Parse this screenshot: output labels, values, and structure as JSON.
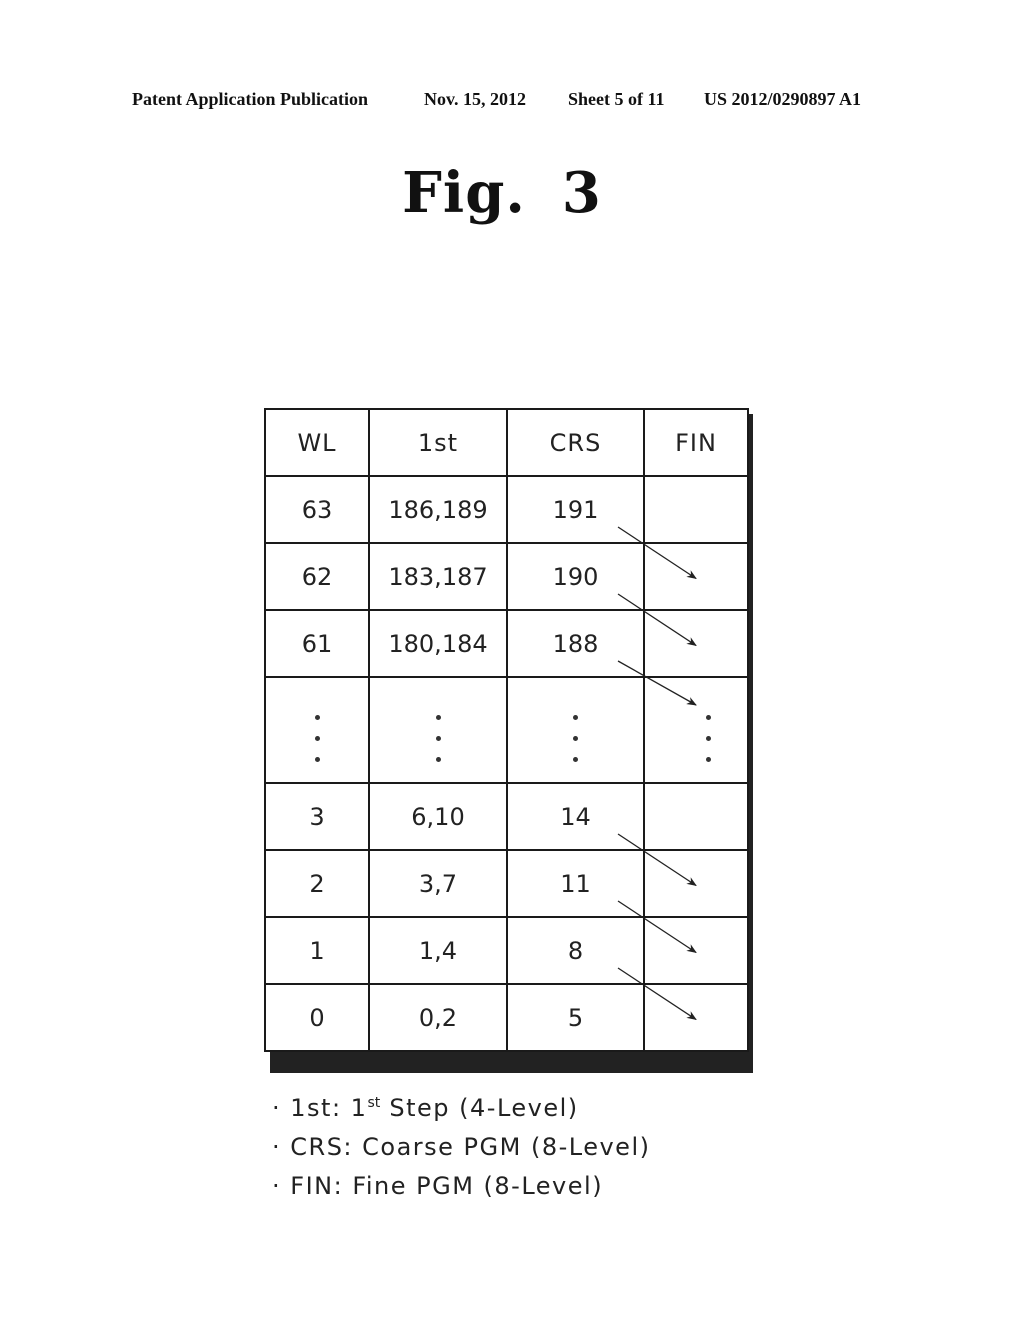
{
  "header": {
    "publication": "Patent Application Publication",
    "date": "Nov. 15, 2012",
    "sheet": "Sheet 5 of 11",
    "number": "US 2012/0290897 A1"
  },
  "figure": {
    "label": "Fig.",
    "number": "3"
  },
  "table": {
    "columns": [
      "WL",
      "1st",
      "CRS",
      "FIN"
    ],
    "rows": [
      {
        "wl": "63",
        "first": "186,189",
        "crs": "191",
        "fin": ""
      },
      {
        "wl": "62",
        "first": "183,187",
        "crs": "190",
        "fin": ""
      },
      {
        "wl": "61",
        "first": "180,184",
        "crs": "188",
        "fin": ""
      },
      {
        "wl": "⋮",
        "first": "⋮",
        "crs": "⋮",
        "fin": "⋮",
        "ellipsis": true
      },
      {
        "wl": "3",
        "first": "6,10",
        "crs": "14",
        "fin": ""
      },
      {
        "wl": "2",
        "first": "3,7",
        "crs": "11",
        "fin": ""
      },
      {
        "wl": "1",
        "first": "1,4",
        "crs": "8",
        "fin": ""
      },
      {
        "wl": "0",
        "first": "0,2",
        "crs": "5",
        "fin": ""
      }
    ],
    "arrows": [
      {
        "from_row": "63",
        "to_row": "62",
        "meaning": "CRS to FIN diagonal order"
      },
      {
        "from_row": "62",
        "to_row": "61"
      },
      {
        "from_row": "61",
        "to_row": "ellipsis"
      },
      {
        "from_row": "3",
        "to_row": "2"
      },
      {
        "from_row": "2",
        "to_row": "1"
      },
      {
        "from_row": "1",
        "to_row": "0"
      }
    ]
  },
  "legend": [
    {
      "bullet": "·",
      "key": "1st:",
      "pre": "1",
      "sup": "st",
      "text": "Step (4-Level)"
    },
    {
      "bullet": "·",
      "key": "CRS:",
      "pre": "",
      "sup": "",
      "text": "Coarse PGM (8-Level)"
    },
    {
      "bullet": "·",
      "key": "FIN:",
      "pre": "",
      "sup": "",
      "text": "Fine PGM (8-Level)"
    }
  ]
}
